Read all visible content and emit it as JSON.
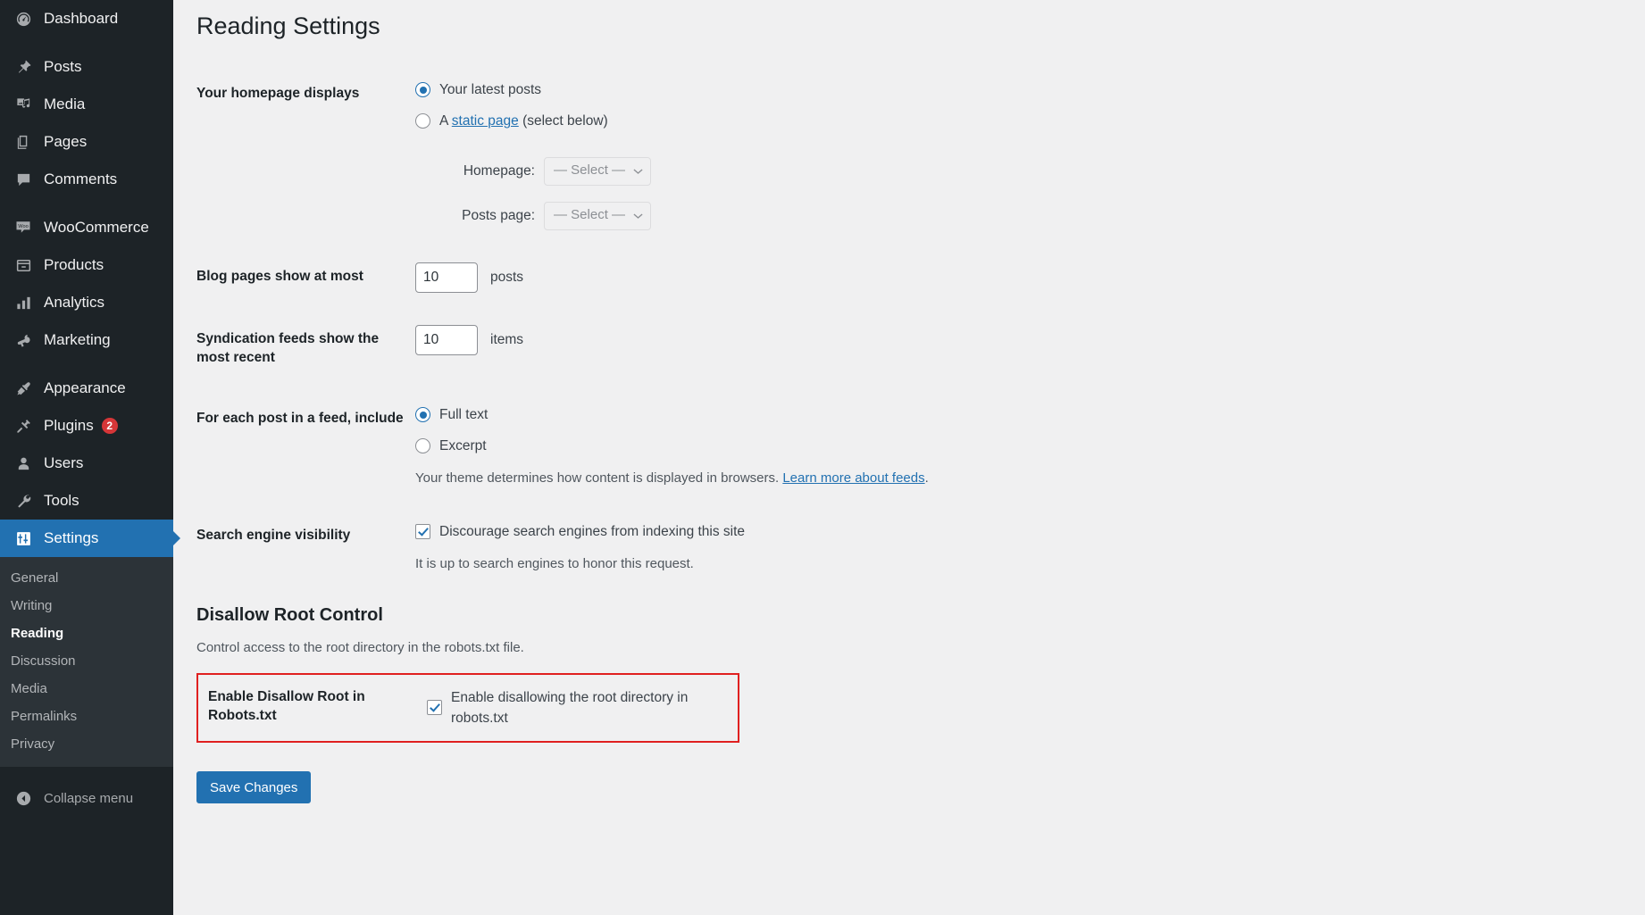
{
  "sidebar": {
    "groups": [
      {
        "items": [
          {
            "label": "Dashboard",
            "icon": "dashboard-icon",
            "name": "dashboard"
          }
        ]
      },
      {
        "items": [
          {
            "label": "Posts",
            "icon": "pin-icon",
            "name": "posts"
          },
          {
            "label": "Media",
            "icon": "media-icon",
            "name": "media"
          },
          {
            "label": "Pages",
            "icon": "pages-icon",
            "name": "pages"
          },
          {
            "label": "Comments",
            "icon": "comment-icon",
            "name": "comments"
          }
        ]
      },
      {
        "items": [
          {
            "label": "WooCommerce",
            "icon": "woo-icon",
            "name": "woocommerce"
          },
          {
            "label": "Products",
            "icon": "products-icon",
            "name": "products"
          },
          {
            "label": "Analytics",
            "icon": "analytics-icon",
            "name": "analytics"
          },
          {
            "label": "Marketing",
            "icon": "megaphone-icon",
            "name": "marketing"
          }
        ]
      },
      {
        "items": [
          {
            "label": "Appearance",
            "icon": "brush-icon",
            "name": "appearance"
          },
          {
            "label": "Plugins",
            "icon": "plug-icon",
            "name": "plugins",
            "badge": "2"
          },
          {
            "label": "Users",
            "icon": "user-icon",
            "name": "users"
          },
          {
            "label": "Tools",
            "icon": "wrench-icon",
            "name": "tools"
          },
          {
            "label": "Settings",
            "icon": "sliders-icon",
            "name": "settings",
            "current": true
          }
        ]
      }
    ],
    "submenu": [
      {
        "label": "General",
        "name": "general"
      },
      {
        "label": "Writing",
        "name": "writing"
      },
      {
        "label": "Reading",
        "name": "reading",
        "current": true
      },
      {
        "label": "Discussion",
        "name": "discussion"
      },
      {
        "label": "Media",
        "name": "media"
      },
      {
        "label": "Permalinks",
        "name": "permalinks"
      },
      {
        "label": "Privacy",
        "name": "privacy"
      }
    ],
    "collapse": {
      "label": "Collapse menu",
      "icon": "collapse-arrow-icon"
    },
    "colors": {
      "background": "#1d2327",
      "submenu_background": "#2c3338",
      "current": "#2271b1",
      "badge": "#d63638"
    }
  },
  "page": {
    "title": "Reading Settings"
  },
  "homepage_displays": {
    "label": "Your homepage displays",
    "option_latest": "Your latest posts",
    "option_static_prefix": "A ",
    "option_static_link": "static page",
    "option_static_suffix": " (select below)",
    "selected": "latest",
    "homepage_label": "Homepage:",
    "homepage_value": "— Select —",
    "posts_page_label": "Posts page:",
    "posts_page_value": "— Select —"
  },
  "blog_pages": {
    "label": "Blog pages show at most",
    "value": "10",
    "suffix": "posts"
  },
  "syndication": {
    "label": "Syndication feeds show the most recent",
    "value": "10",
    "suffix": "items"
  },
  "feed_include": {
    "label": "For each post in a feed, include",
    "option_full": "Full text",
    "option_excerpt": "Excerpt",
    "selected": "full",
    "helper_prefix": "Your theme determines how content is displayed in browsers. ",
    "helper_link": "Learn more about feeds",
    "helper_suffix": "."
  },
  "search_visibility": {
    "label": "Search engine visibility",
    "checkbox_label": "Discourage search engines from indexing this site",
    "checked": true,
    "helper": "It is up to search engines to honor this request."
  },
  "disallow_root": {
    "section_title": "Disallow Root Control",
    "section_desc": "Control access to the root directory in the robots.txt file.",
    "row_label": "Enable Disallow Root in Robots.txt",
    "checkbox_label": "Enable disallowing the root directory in robots.txt",
    "checked": true,
    "highlight_color": "#e02020"
  },
  "footer": {
    "save_label": "Save Changes",
    "save_color": "#2271b1"
  }
}
